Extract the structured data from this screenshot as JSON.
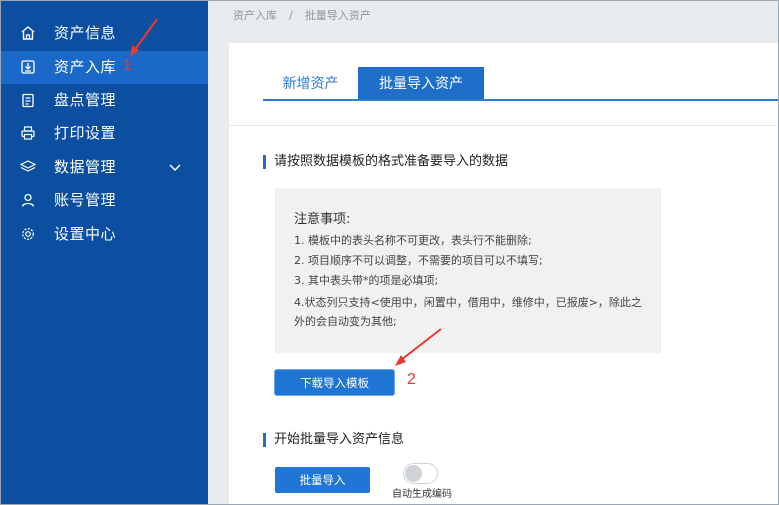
{
  "sidebar": {
    "items": [
      {
        "label": "资产信息",
        "icon": "home-icon"
      },
      {
        "label": "资产入库",
        "icon": "import-icon",
        "active": true
      },
      {
        "label": "盘点管理",
        "icon": "clipboard-icon"
      },
      {
        "label": "打印设置",
        "icon": "printer-icon"
      },
      {
        "label": "数据管理",
        "icon": "layers-icon",
        "has_submenu": true
      },
      {
        "label": "账号管理",
        "icon": "user-icon"
      },
      {
        "label": "设置中心",
        "icon": "gear-icon"
      }
    ]
  },
  "breadcrumb": {
    "parent": "资产入库",
    "separator": "/",
    "current": "批量导入资产"
  },
  "tabs": [
    {
      "label": "新增资产",
      "active": false
    },
    {
      "label": "批量导入资产",
      "active": true
    }
  ],
  "section1": {
    "title": "请按照数据模板的格式准备要导入的数据"
  },
  "notice": {
    "title": "注意事项:",
    "lines": [
      "1. 模板中的表头名称不可更改，表头行不能删除;",
      "2. 项目顺序不可以调整，不需要的项目可以不填写;",
      "3. 其中表头带*的项是必填项;",
      "4.状态列只支持<使用中，闲置中，借用中，维修中，已报废>，除此之外的会自动变为其他;"
    ]
  },
  "download_button": {
    "label": "下载导入模板"
  },
  "section2": {
    "title": "开始批量导入资产信息"
  },
  "batch_button": {
    "label": "批量导入"
  },
  "auto_code": {
    "label": "自动生成编码",
    "enabled": false
  },
  "annotations": {
    "step1": "1",
    "step2": "2",
    "color": "#e8392f"
  },
  "colors": {
    "sidebar_bg": "#0c4fa0",
    "sidebar_active": "#1a68c8",
    "accent": "#1f76d4"
  }
}
